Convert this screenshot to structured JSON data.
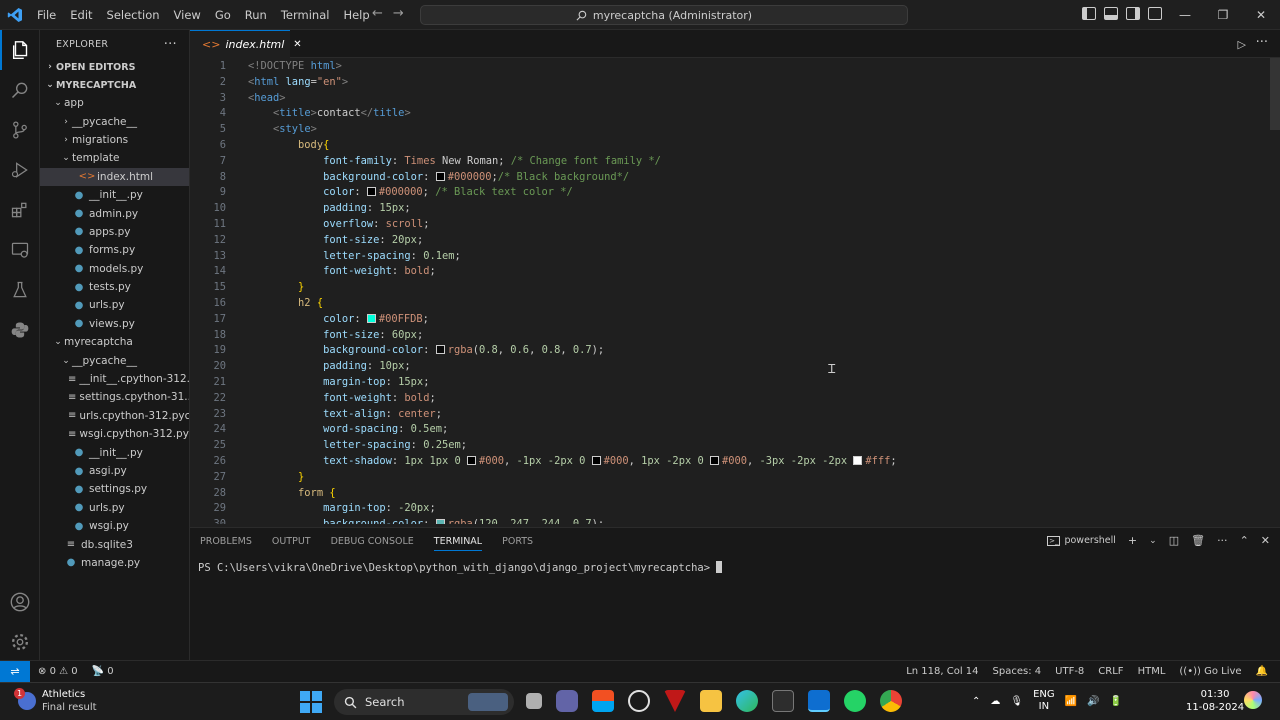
{
  "titlebar": {
    "menu": [
      "File",
      "Edit",
      "Selection",
      "View",
      "Go",
      "Run",
      "Terminal",
      "Help"
    ],
    "command_center": "myrecaptcha (Administrator)"
  },
  "sidebar": {
    "title": "EXPLORER",
    "open_editors": "OPEN EDITORS",
    "project": "MYRECAPTCHA",
    "tree": [
      {
        "label": "app",
        "type": "folder-open",
        "indent": 1
      },
      {
        "label": "__pycache__",
        "type": "folder",
        "indent": 2
      },
      {
        "label": "migrations",
        "type": "folder",
        "indent": 2
      },
      {
        "label": "template",
        "type": "folder-open",
        "indent": 2
      },
      {
        "label": "index.html",
        "type": "html",
        "indent": 3,
        "selected": true
      },
      {
        "label": "__init__.py",
        "type": "py",
        "indent": 2
      },
      {
        "label": "admin.py",
        "type": "py",
        "indent": 2
      },
      {
        "label": "apps.py",
        "type": "py",
        "indent": 2
      },
      {
        "label": "forms.py",
        "type": "py",
        "indent": 2
      },
      {
        "label": "models.py",
        "type": "py",
        "indent": 2
      },
      {
        "label": "tests.py",
        "type": "py",
        "indent": 2
      },
      {
        "label": "urls.py",
        "type": "py",
        "indent": 2
      },
      {
        "label": "views.py",
        "type": "py",
        "indent": 2
      },
      {
        "label": "myrecaptcha",
        "type": "folder-open",
        "indent": 1
      },
      {
        "label": "__pycache__",
        "type": "folder-open",
        "indent": 2
      },
      {
        "label": "__init__.cpython-312....",
        "type": "pyc",
        "indent": 3
      },
      {
        "label": "settings.cpython-31...",
        "type": "pyc",
        "indent": 3
      },
      {
        "label": "urls.cpython-312.pyc",
        "type": "pyc",
        "indent": 3
      },
      {
        "label": "wsgi.cpython-312.pyc",
        "type": "pyc",
        "indent": 3
      },
      {
        "label": "__init__.py",
        "type": "py",
        "indent": 2
      },
      {
        "label": "asgi.py",
        "type": "py",
        "indent": 2
      },
      {
        "label": "settings.py",
        "type": "py",
        "indent": 2
      },
      {
        "label": "urls.py",
        "type": "py",
        "indent": 2
      },
      {
        "label": "wsgi.py",
        "type": "py",
        "indent": 2
      },
      {
        "label": "db.sqlite3",
        "type": "db",
        "indent": 1
      },
      {
        "label": "manage.py",
        "type": "py",
        "indent": 1
      }
    ]
  },
  "editor": {
    "tab_label": "index.html",
    "lines": [
      [
        [
          "k",
          "<!DOCTYPE "
        ],
        [
          "t",
          "html"
        ],
        [
          "k",
          ">"
        ]
      ],
      [
        [
          "k",
          "<"
        ],
        [
          "t",
          "html"
        ],
        [
          "a",
          " lang"
        ],
        [
          "x",
          "="
        ],
        [
          "s",
          "\"en\""
        ],
        [
          "k",
          ">"
        ]
      ],
      [
        [
          "k",
          "<"
        ],
        [
          "t",
          "head"
        ],
        [
          "k",
          ">"
        ]
      ],
      [
        [
          "x",
          "    "
        ],
        [
          "k",
          "<"
        ],
        [
          "t",
          "title"
        ],
        [
          "k",
          ">"
        ],
        [
          "x",
          "contact"
        ],
        [
          "k",
          "</"
        ],
        [
          "t",
          "title"
        ],
        [
          "k",
          ">"
        ]
      ],
      [
        [
          "x",
          "    "
        ],
        [
          "k",
          "<"
        ],
        [
          "t",
          "style"
        ],
        [
          "k",
          ">"
        ]
      ],
      [
        [
          "x",
          "        "
        ],
        [
          "sel",
          "body"
        ],
        [
          "br",
          "{"
        ]
      ],
      [
        [
          "x",
          "            "
        ],
        [
          "p",
          "font-family"
        ],
        [
          "x",
          ": "
        ],
        [
          "v",
          "Times"
        ],
        [
          "x",
          " New Roman; "
        ],
        [
          "c",
          "/* Change font family */"
        ]
      ],
      [
        [
          "x",
          "            "
        ],
        [
          "p",
          "background-color"
        ],
        [
          "x",
          ": "
        ],
        [
          "sw",
          "#000000"
        ],
        [
          "v",
          "#000000"
        ],
        [
          "x",
          ";"
        ],
        [
          "c",
          "/* Black background*/"
        ]
      ],
      [
        [
          "x",
          "            "
        ],
        [
          "p",
          "color"
        ],
        [
          "x",
          ": "
        ],
        [
          "sw",
          "#000000"
        ],
        [
          "v",
          "#000000"
        ],
        [
          "x",
          "; "
        ],
        [
          "c",
          "/* Black text color */"
        ]
      ],
      [
        [
          "x",
          "            "
        ],
        [
          "p",
          "padding"
        ],
        [
          "x",
          ": "
        ],
        [
          "n",
          "15px"
        ],
        [
          "x",
          ";"
        ]
      ],
      [
        [
          "x",
          "            "
        ],
        [
          "p",
          "overflow"
        ],
        [
          "x",
          ": "
        ],
        [
          "v",
          "scroll"
        ],
        [
          "x",
          ";"
        ]
      ],
      [
        [
          "x",
          "            "
        ],
        [
          "p",
          "font-size"
        ],
        [
          "x",
          ": "
        ],
        [
          "n",
          "20px"
        ],
        [
          "x",
          ";"
        ]
      ],
      [
        [
          "x",
          "            "
        ],
        [
          "p",
          "letter-spacing"
        ],
        [
          "x",
          ": "
        ],
        [
          "n",
          "0.1em"
        ],
        [
          "x",
          ";"
        ]
      ],
      [
        [
          "x",
          "            "
        ],
        [
          "p",
          "font-weight"
        ],
        [
          "x",
          ": "
        ],
        [
          "v",
          "bold"
        ],
        [
          "x",
          ";"
        ]
      ],
      [
        [
          "x",
          "        "
        ],
        [
          "br",
          "}"
        ]
      ],
      [
        [
          "x",
          "        "
        ],
        [
          "sel",
          "h2"
        ],
        [
          "x",
          " "
        ],
        [
          "br",
          "{"
        ]
      ],
      [
        [
          "x",
          "            "
        ],
        [
          "p",
          "color"
        ],
        [
          "x",
          ": "
        ],
        [
          "sw",
          "#00FFDB"
        ],
        [
          "v",
          "#00FFDB"
        ],
        [
          "x",
          ";"
        ]
      ],
      [
        [
          "x",
          "            "
        ],
        [
          "p",
          "font-size"
        ],
        [
          "x",
          ": "
        ],
        [
          "n",
          "60px"
        ],
        [
          "x",
          ";"
        ]
      ],
      [
        [
          "x",
          "            "
        ],
        [
          "p",
          "background-color"
        ],
        [
          "x",
          ": "
        ],
        [
          "sw",
          "rgba(0.8,0.6,0.8,0.7)"
        ],
        [
          "v",
          "rgba"
        ],
        [
          "x",
          "("
        ],
        [
          "n",
          "0.8"
        ],
        [
          "x",
          ", "
        ],
        [
          "n",
          "0.6"
        ],
        [
          "x",
          ", "
        ],
        [
          "n",
          "0.8"
        ],
        [
          "x",
          ", "
        ],
        [
          "n",
          "0.7"
        ],
        [
          "x",
          ");"
        ]
      ],
      [
        [
          "x",
          "            "
        ],
        [
          "p",
          "padding"
        ],
        [
          "x",
          ": "
        ],
        [
          "n",
          "10px"
        ],
        [
          "x",
          ";"
        ]
      ],
      [
        [
          "x",
          "            "
        ],
        [
          "p",
          "margin-top"
        ],
        [
          "x",
          ": "
        ],
        [
          "n",
          "15px"
        ],
        [
          "x",
          ";"
        ]
      ],
      [
        [
          "x",
          "            "
        ],
        [
          "p",
          "font-weight"
        ],
        [
          "x",
          ": "
        ],
        [
          "v",
          "bold"
        ],
        [
          "x",
          ";"
        ]
      ],
      [
        [
          "x",
          "            "
        ],
        [
          "p",
          "text-align"
        ],
        [
          "x",
          ": "
        ],
        [
          "v",
          "center"
        ],
        [
          "x",
          ";"
        ]
      ],
      [
        [
          "x",
          "            "
        ],
        [
          "p",
          "word-spacing"
        ],
        [
          "x",
          ": "
        ],
        [
          "n",
          "0.5em"
        ],
        [
          "x",
          ";"
        ]
      ],
      [
        [
          "x",
          "            "
        ],
        [
          "p",
          "letter-spacing"
        ],
        [
          "x",
          ": "
        ],
        [
          "n",
          "0.25em"
        ],
        [
          "x",
          ";"
        ]
      ],
      [
        [
          "x",
          "            "
        ],
        [
          "p",
          "text-shadow"
        ],
        [
          "x",
          ": "
        ],
        [
          "n",
          "1px 1px 0 "
        ],
        [
          "sw",
          "#000"
        ],
        [
          "v",
          "#000"
        ],
        [
          "x",
          ", "
        ],
        [
          "n",
          "-1px -2px 0 "
        ],
        [
          "sw",
          "#000"
        ],
        [
          "v",
          "#000"
        ],
        [
          "x",
          ", "
        ],
        [
          "n",
          "1px -2px 0 "
        ],
        [
          "sw",
          "#000"
        ],
        [
          "v",
          "#000"
        ],
        [
          "x",
          ", "
        ],
        [
          "n",
          "-3px -2px -2px "
        ],
        [
          "sw",
          "#fff"
        ],
        [
          "v",
          "#fff"
        ],
        [
          "x",
          ";"
        ]
      ],
      [
        [
          "x",
          "        "
        ],
        [
          "br",
          "}"
        ]
      ],
      [
        [
          "x",
          "        "
        ],
        [
          "sel",
          "form"
        ],
        [
          "x",
          " "
        ],
        [
          "br",
          "{"
        ]
      ],
      [
        [
          "x",
          "            "
        ],
        [
          "p",
          "margin-top"
        ],
        [
          "x",
          ": "
        ],
        [
          "n",
          "-20px"
        ],
        [
          "x",
          ";"
        ]
      ],
      [
        [
          "x",
          "            "
        ],
        [
          "p",
          "background-color"
        ],
        [
          "x",
          ": "
        ],
        [
          "sw",
          "rgba(120,247,244,0.7)"
        ],
        [
          "v",
          "rgba"
        ],
        [
          "x",
          "("
        ],
        [
          "n",
          "120"
        ],
        [
          "x",
          ", "
        ],
        [
          "n",
          "247"
        ],
        [
          "x",
          ", "
        ],
        [
          "n",
          "244"
        ],
        [
          "x",
          ", "
        ],
        [
          "n",
          "0.7"
        ],
        [
          "x",
          ");"
        ]
      ]
    ]
  },
  "panel": {
    "tabs": [
      "PROBLEMS",
      "OUTPUT",
      "DEBUG CONSOLE",
      "TERMINAL",
      "PORTS"
    ],
    "active_tab": "TERMINAL",
    "shell": "powershell",
    "prompt": "PS C:\\Users\\vikra\\OneDrive\\Desktop\\python_with_django\\django_project\\myrecaptcha> "
  },
  "statusbar": {
    "errors": "0",
    "warnings": "0",
    "ports": "0",
    "position": "Ln 118, Col 14",
    "spaces": "Spaces: 4",
    "encoding": "UTF-8",
    "eol": "CRLF",
    "language": "HTML",
    "golive": "Go Live"
  },
  "taskbar": {
    "weather_title": "Athletics",
    "weather_sub": "Final result",
    "weather_badge": "1",
    "search": "Search",
    "lang1": "ENG",
    "lang2": "IN",
    "time": "01:30",
    "date": "11-08-2024"
  },
  "colors": {
    "accent": "#0078d4",
    "editor_bg": "#1f1f1f",
    "sidebar_bg": "#181818"
  }
}
